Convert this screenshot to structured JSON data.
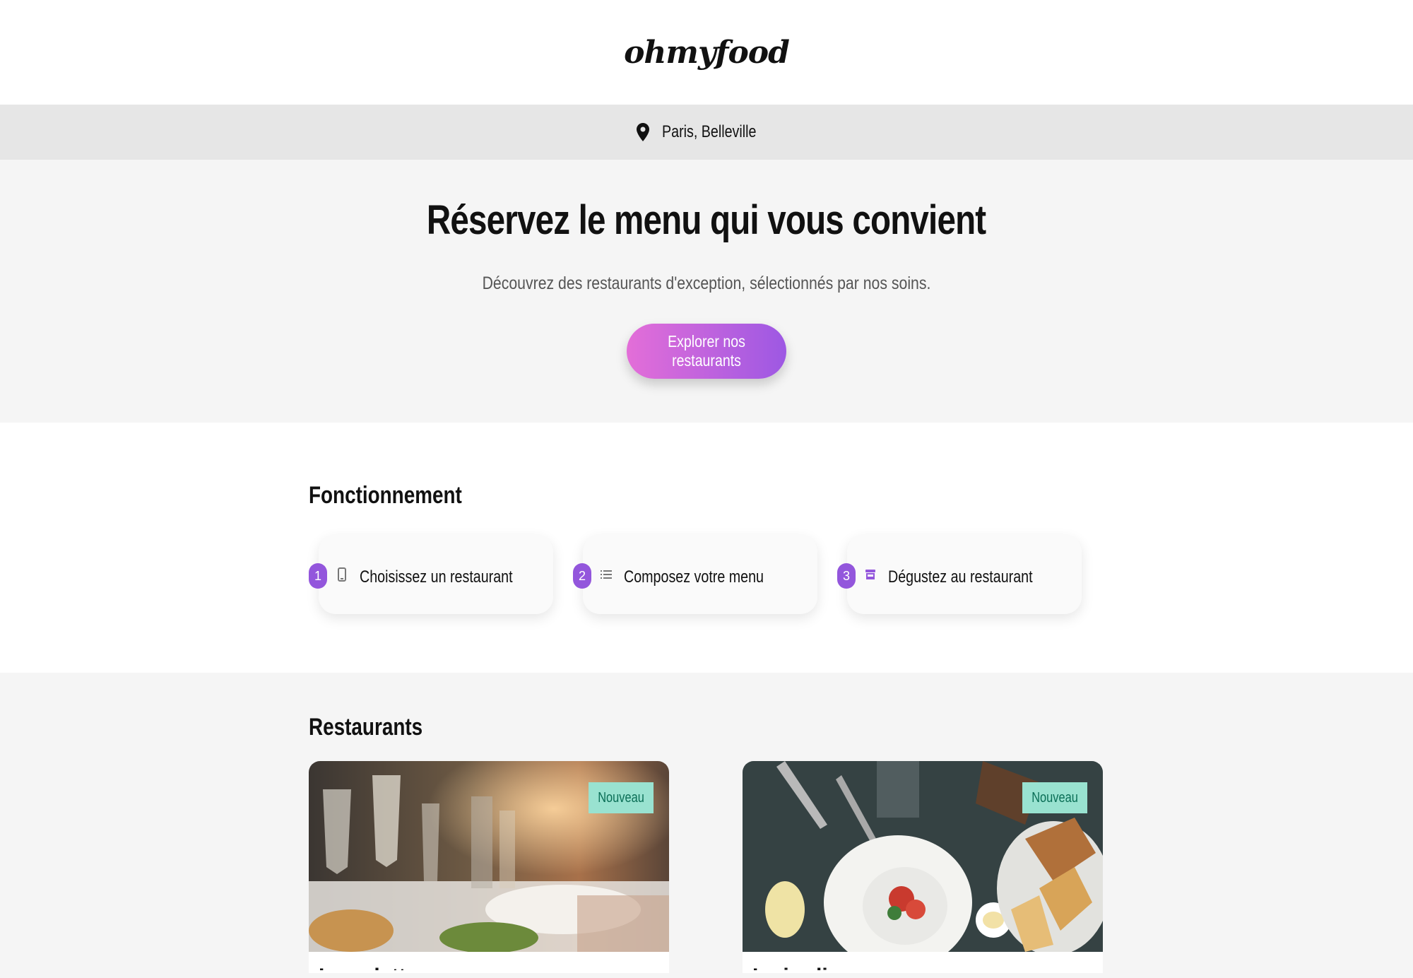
{
  "header": {
    "logo": "ohmyfood"
  },
  "location": {
    "icon": "map-pin-icon",
    "text": "Paris, Belleville"
  },
  "hero": {
    "title": "Réservez le menu qui vous convient",
    "subtitle": "Découvrez des restaurants d'exception, sélectionnés par nos soins.",
    "cta_label": "Explorer nos restaurants"
  },
  "how": {
    "title": "Fonctionnement",
    "steps": [
      {
        "number": "1",
        "icon": "phone-icon",
        "label": "Choisissez un restaurant"
      },
      {
        "number": "2",
        "icon": "list-icon",
        "label": "Composez votre menu"
      },
      {
        "number": "3",
        "icon": "store-icon",
        "label": "Dégustez au restaurant"
      }
    ]
  },
  "restaurants": {
    "title": "Restaurants",
    "cards": [
      {
        "badge": "Nouveau",
        "name": "La palette du goût"
      },
      {
        "badge": "Nouveau",
        "name": "Le jardin des délices"
      }
    ]
  },
  "colors": {
    "accent": "#9356dc",
    "cta_start": "#e36ed8",
    "cta_end": "#9d58e3",
    "badge_bg": "#99e2d0",
    "badge_text": "#0a6e56"
  }
}
